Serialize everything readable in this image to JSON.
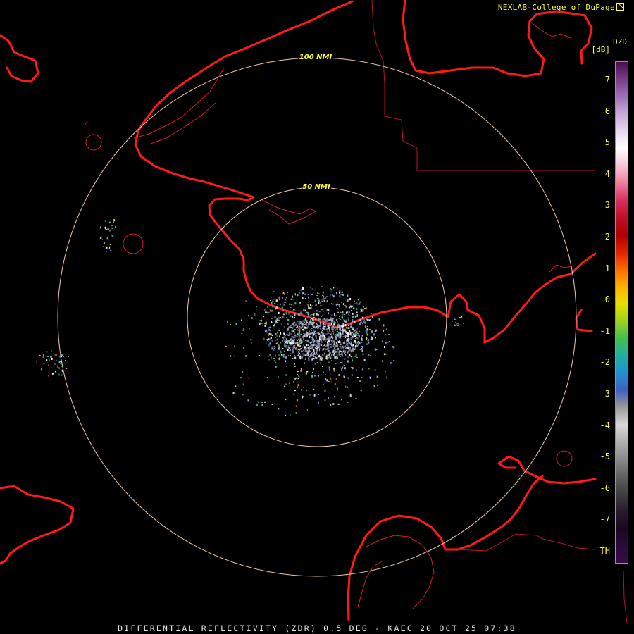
{
  "credit": "NEXLAB-College of DuPage",
  "credit_icon": "external-link-icon",
  "legend": {
    "title": "DZD",
    "unit": "[dB]",
    "ticks": [
      "7",
      "6",
      "5",
      "4",
      "3",
      "2",
      "1",
      "0",
      "-1",
      "-2",
      "-3",
      "-4",
      "-5",
      "-6",
      "-7",
      "TH"
    ],
    "colors": [
      "#4b0d4f",
      "#7a3a86",
      "#a070b6",
      "#c8a8d8",
      "#e6d6ef",
      "#ffffff",
      "#f7c6d6",
      "#ee7fa2",
      "#d8305c",
      "#c0102a",
      "#b00000",
      "#e02000",
      "#ff6a00",
      "#ffb000",
      "#e8e000",
      "#a0d020",
      "#40c050",
      "#20b0a0",
      "#2090d0",
      "#4060c0",
      "#9a9a9a",
      "#d8d8d8",
      "#b0b0b0",
      "#8a8a8a",
      "#606060",
      "#404040",
      "#2a1a30",
      "#1a0820",
      "#2a0a3a",
      "#3a0a4a"
    ]
  },
  "rings": [
    "100 NMI",
    "50 NMI"
  ],
  "footer": "DIFFERENTIAL REFLECTIVITY (ZDR) 0.5 DEG - KAEC 20 OCT 25 07:38"
}
